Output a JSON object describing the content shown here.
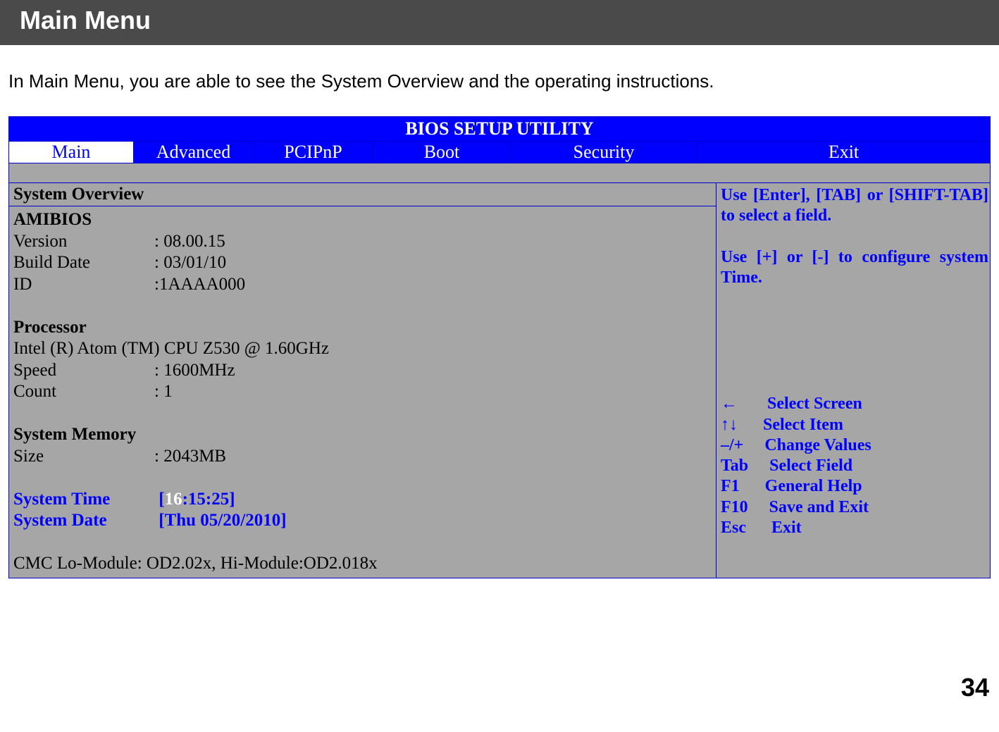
{
  "title_bar": "Main Menu",
  "intro": "In Main Menu, you are able to see the System Overview and the operating instructions.",
  "bios": {
    "header": "BIOS SETUP UTILITY",
    "tabs": {
      "main": "Main",
      "advanced": "Advanced",
      "pcipnp": "PCIPnP",
      "boot": "Boot",
      "security": "Security",
      "exit": "Exit"
    },
    "section_header": "System Overview",
    "amibios": {
      "heading": "AMIBIOS",
      "version_label": "Version",
      "version_value": ": 08.00.15",
      "builddate_label": "Build Date",
      "builddate_value": ": 03/01/10",
      "id_label": "ID",
      "id_value": ":1AAAA000"
    },
    "processor": {
      "heading": "Processor",
      "name": "Intel (R) Atom (TM) CPU Z530 @ 1.60GHz",
      "speed_label": "Speed",
      "speed_value": ": 1600MHz",
      "count_label": "Count",
      "count_value": ": 1"
    },
    "memory": {
      "heading": "System Memory",
      "size_label": "Size",
      "size_value": ": 2043MB"
    },
    "system_time": {
      "label": "System Time",
      "open": "[",
      "active": "16",
      "rest": ":15:25]"
    },
    "system_date": {
      "label": "System Date",
      "value": "[Thu 05/20/2010]"
    },
    "cmc": "CMC Lo-Module: OD2.02x, Hi-Module:OD2.018x",
    "help": {
      "top1": "Use [Enter], [TAB] or [SHIFT-TAB] to select a field.",
      "top2": "Use [+] or [-] to configure system Time.",
      "k1": "←       Select Screen",
      "k2": "↑↓      Select Item",
      "k3": "–/+     Change Values",
      "k4": "Tab     Select Field",
      "k5": "F1      General Help",
      "k6": "F10     Save and Exit",
      "k7": "Esc      Exit"
    }
  },
  "page_number": "34"
}
